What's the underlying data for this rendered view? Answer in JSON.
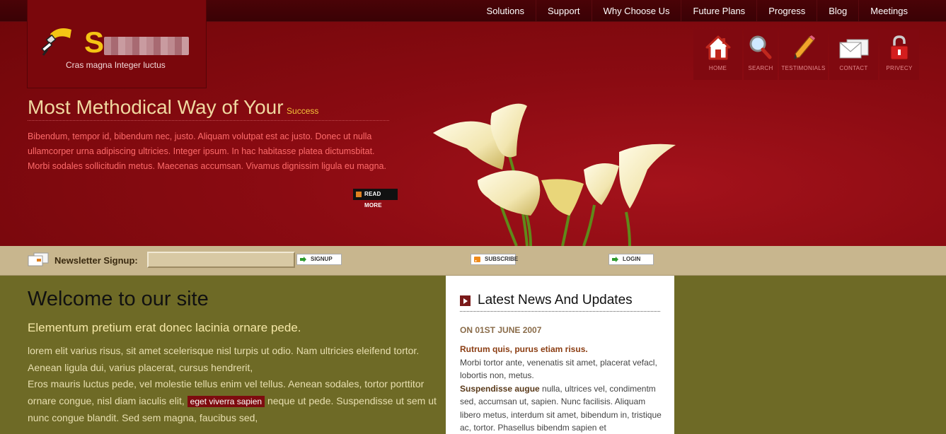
{
  "top_nav": [
    "Solutions",
    "Support",
    "Why Choose Us",
    "Future Plans",
    "Progress",
    "Blog",
    "Meetings"
  ],
  "logo": {
    "tagline": "Cras magna Integer luctus",
    "visible_letter": "S"
  },
  "icon_nav": [
    {
      "label": "HOME",
      "icon": "home-icon"
    },
    {
      "label": "SEARCH",
      "icon": "search-icon"
    },
    {
      "label": "TESTIMONIALS",
      "icon": "pencil-icon"
    },
    {
      "label": "CONTACT",
      "icon": "envelope-icon"
    },
    {
      "label": "PRIVECY",
      "icon": "lock-icon"
    }
  ],
  "hero": {
    "title": "Most Methodical Way of Your",
    "title_small": "Success",
    "text": "Bibendum, tempor id, bibendum nec, justo. Aliquam volutpat est ac justo. Donec ut nulla ullamcorper urna adipiscing ultricies. Integer ipsum. In hac habitasse platea dictumsbitat. Morbi sodales sollicitudin metus. Maecenas accumsan. Vivamus dignissim ligula eu magna.",
    "read_more": "READ MORE"
  },
  "newsletter": {
    "label": "Newsletter Signup:",
    "input_value": "",
    "signup": "SIGNUP",
    "subscribe": "SUBSCRIBE",
    "login": "LOGIN"
  },
  "content": {
    "welcome": "Welcome to our site",
    "subhead": "Elementum pretium erat donec lacinia ornare pede.",
    "p1": "lorem elit varius risus, sit amet scelerisque nisl turpis ut odio. Nam ultricies eleifend tortor. Aenean ligula dui, varius placerat, cursus hendrerit,",
    "p2a": "Eros mauris luctus pede, vel molestie tellus enim vel tellus. Aenean sodales, tortor porttitor ornare congue, nisl diam iaculis elit,",
    "highlight": "eget viverra sapien",
    "p2b": "neque ut pede. Suspendisse ut sem ut nunc congue blandit. Sed sem magna, faucibus sed,"
  },
  "news": {
    "title": "Latest News And Updates",
    "date": "ON 01ST JUNE 2007",
    "item1_title": "Rutrum quis, purus etiam risus.",
    "item1_text": "Morbi tortor ante, venenatis sit amet, placerat vefacl, lobortis non, metus.",
    "item2_title": "Suspendisse augue",
    "item2_text": "nulla, ultrices vel, condimentm sed, accumsan ut, sapien. Nunc facilisis. Aliquam libero metus, interdum sit amet, bibendum in, tristique ac, tortor. Phasellus bibendm sapien et"
  },
  "colors": {
    "hero_red": "#8b0b12",
    "olive": "#6e6a26",
    "newsletter_tan": "#c8b68e",
    "accent_yellow": "#f4c414"
  }
}
